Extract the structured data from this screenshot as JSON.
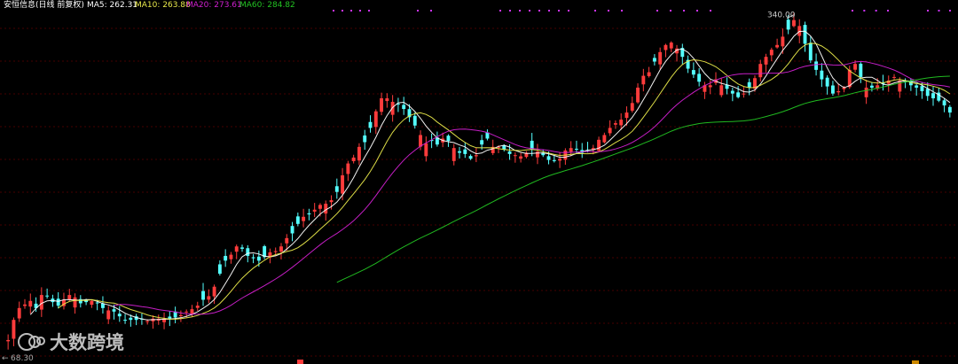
{
  "chart_data": {
    "type": "candlestick",
    "title": "安恒信息(日线 前复权)",
    "indicators": [
      {
        "name": "MA5",
        "value_label": "262.31",
        "color": "#ffffff"
      },
      {
        "name": "MA10",
        "value_label": "263.88",
        "color": "#e8e84a"
      },
      {
        "name": "MA20",
        "value_label": "273.61",
        "color": "#d020d0"
      },
      {
        "name": "MA60",
        "value_label": "284.82",
        "color": "#22c322"
      }
    ],
    "high_label": "340.00",
    "low_label": "68.30",
    "ylim": [
      55,
      345
    ],
    "colors": {
      "up": "#ff3c3c",
      "down": "#54ffff",
      "background": "#000000",
      "grid": "#8b0000",
      "marker": "#cc33ff"
    },
    "closes": [
      70,
      87,
      97,
      100,
      103,
      97,
      108,
      107,
      102,
      99,
      104,
      108,
      106,
      101,
      102,
      103,
      101,
      97,
      95,
      94,
      90,
      87,
      87,
      87,
      88,
      86,
      88,
      88,
      88,
      88,
      89,
      91,
      94,
      96,
      99,
      104,
      107,
      115,
      126,
      137,
      142,
      149,
      147,
      141,
      139,
      137,
      140,
      144,
      145,
      149,
      156,
      160,
      168,
      174,
      176,
      180,
      184,
      185,
      188,
      195,
      209,
      219,
      224,
      233,
      237,
      249,
      263,
      274,
      274,
      271,
      269,
      265,
      258,
      251,
      243,
      236,
      238,
      235,
      240,
      238,
      232,
      228,
      227,
      223,
      226,
      235,
      240,
      233,
      233,
      231,
      227,
      226,
      225,
      228,
      231,
      229,
      226,
      222,
      221,
      223,
      230,
      232,
      231,
      228,
      230,
      232,
      239,
      243,
      249,
      253,
      256,
      262,
      270,
      283,
      293,
      296,
      305,
      313,
      319,
      321,
      316,
      309,
      299,
      294,
      288,
      285,
      285,
      290,
      285,
      282,
      278,
      275,
      278,
      283,
      291,
      303,
      309,
      315,
      319,
      326,
      332,
      340,
      335,
      320,
      306,
      298,
      290,
      284,
      278,
      280,
      283,
      298,
      303,
      292,
      283,
      283,
      285,
      286,
      289,
      292,
      289,
      288,
      285,
      283,
      280,
      276,
      274,
      272,
      268,
      262
    ],
    "markers": [
      "top-cluster-1",
      "top-cluster-2",
      "top-cluster-3"
    ],
    "watermark": "大数跨境"
  }
}
